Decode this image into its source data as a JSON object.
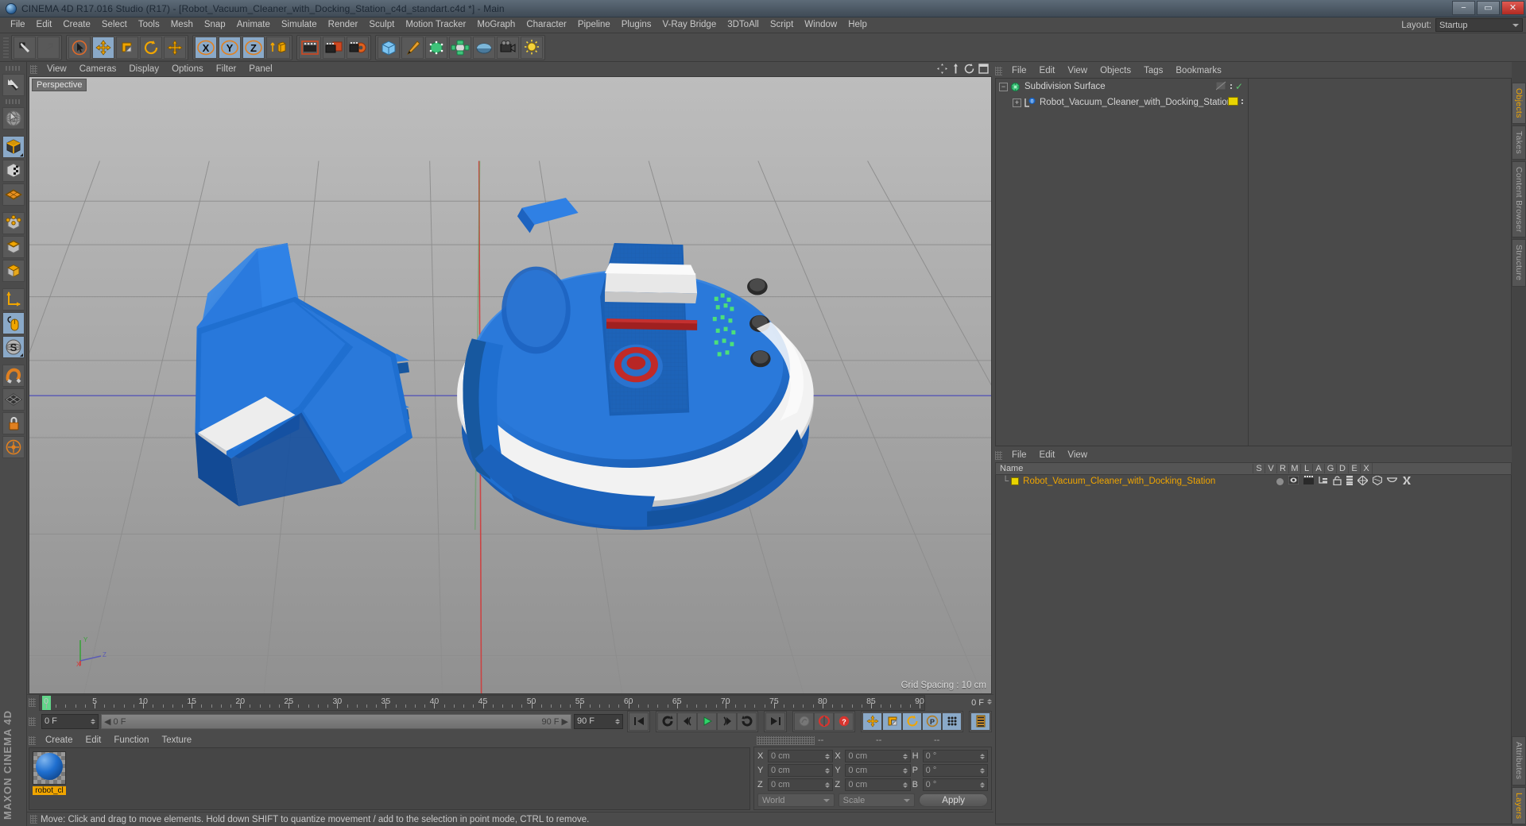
{
  "window": {
    "title": "CINEMA 4D R17.016 Studio (R17) - [Robot_Vacuum_Cleaner_with_Docking_Station_c4d_standart.c4d *] - Main",
    "minimize": "−",
    "maximize": "▭",
    "close": "✕"
  },
  "menubar": {
    "items": [
      "File",
      "Edit",
      "Create",
      "Select",
      "Tools",
      "Mesh",
      "Snap",
      "Animate",
      "Simulate",
      "Render",
      "Sculpt",
      "Motion Tracker",
      "MoGraph",
      "Character",
      "Pipeline",
      "Plugins",
      "V-Ray Bridge",
      "3DToAll",
      "Script",
      "Window",
      "Help"
    ],
    "layout_label": "Layout:",
    "layout_value": "Startup"
  },
  "toolbar": {
    "groups": [
      {
        "name": "undo-redo",
        "buttons": [
          {
            "icon": "undo-icon",
            "label": "Undo",
            "active": false
          },
          {
            "icon": "redo-icon",
            "label": "Redo",
            "active": false
          }
        ]
      },
      {
        "name": "tools",
        "buttons": [
          {
            "icon": "select-icon",
            "label": "Live Selection",
            "active": false
          },
          {
            "icon": "move-icon",
            "label": "Move",
            "active": true
          },
          {
            "icon": "scale-icon",
            "label": "Scale",
            "active": false
          },
          {
            "icon": "rotate-icon",
            "label": "Rotate",
            "active": false
          },
          {
            "icon": "move-axis-icon",
            "label": "Move Axis",
            "active": false
          }
        ]
      },
      {
        "name": "axis-locks",
        "buttons": [
          {
            "icon": "x-axis-icon",
            "label": "X Axis",
            "active": true
          },
          {
            "icon": "y-axis-icon",
            "label": "Y Axis",
            "active": true
          },
          {
            "icon": "z-axis-icon",
            "label": "Z Axis",
            "active": true
          },
          {
            "icon": "world-object-icon",
            "label": "World/Object Coordinate System",
            "active": false
          }
        ]
      },
      {
        "name": "render",
        "buttons": [
          {
            "icon": "render-view-icon",
            "label": "Render View",
            "active": false
          },
          {
            "icon": "render-picture-viewer-icon",
            "label": "Render to Picture Viewer",
            "active": false
          },
          {
            "icon": "render-settings-icon",
            "label": "Edit Render Settings",
            "active": false
          }
        ]
      },
      {
        "name": "objects",
        "buttons": [
          {
            "icon": "cube-primitive-icon",
            "label": "Add Cube Object",
            "active": false
          },
          {
            "icon": "pen-spline-icon",
            "label": "Add Spline Object",
            "active": false
          },
          {
            "icon": "generator-icon",
            "label": "Add Generator Object",
            "active": false
          },
          {
            "icon": "deformer-icon",
            "label": "Add Bend Object",
            "active": false
          },
          {
            "icon": "environment-icon",
            "label": "Add Environment Object",
            "active": false
          },
          {
            "icon": "camera-icon",
            "label": "Add Camera",
            "active": false
          },
          {
            "icon": "light-icon",
            "label": "Add Light",
            "active": false
          }
        ]
      }
    ]
  },
  "lefttoolbar": {
    "buttons": [
      {
        "icon": "undo-big-icon",
        "label": "Undo",
        "active": false
      },
      {
        "icon": "live-selection-icon",
        "label": "Live Selection",
        "active": false
      },
      {
        "icon": "model-mode-icon",
        "label": "Model Mode",
        "active": true
      },
      {
        "icon": "texture-mode-icon",
        "label": "Texture Mode",
        "active": false
      },
      {
        "icon": "workplane-icon",
        "label": "Workplane",
        "active": false
      },
      {
        "icon": "points-mode-icon",
        "label": "Points Mode",
        "active": false
      },
      {
        "icon": "edges-mode-icon",
        "label": "Edges Mode",
        "active": false
      },
      {
        "icon": "polygons-mode-icon",
        "label": "Polygons Mode",
        "active": false
      },
      {
        "icon": "axis-mode-icon",
        "label": "Enable Axis Modification",
        "active": false
      },
      {
        "icon": "viewport-solo-icon",
        "label": "Enable Snapping",
        "active": true
      },
      {
        "icon": "soft-selection-icon",
        "label": "Soft Selection",
        "active": true
      },
      {
        "icon": "magnet-icon",
        "label": "Magnet",
        "active": false
      },
      {
        "icon": "grid-icon",
        "label": "Grid Snap",
        "active": false
      },
      {
        "icon": "lock-icon",
        "label": "Lock Workplane",
        "active": false
      },
      {
        "icon": "workplane-mode-icon",
        "label": "Planar Workplane",
        "active": false
      }
    ],
    "brand": "MAXON CINEMA 4D"
  },
  "viewport": {
    "menu": [
      "View",
      "Cameras",
      "Display",
      "Options",
      "Filter",
      "Panel"
    ],
    "label": "Perspective",
    "grid_spacing": "Grid Spacing : 10 cm",
    "axis": {
      "x": "X",
      "y": "Y",
      "z": "Z"
    },
    "icons": [
      "pan-icon",
      "zoom-icon",
      "rotate-view-icon",
      "maximize-view-icon"
    ]
  },
  "timeline": {
    "ticks": [
      0,
      5,
      10,
      15,
      20,
      25,
      30,
      35,
      40,
      45,
      50,
      55,
      60,
      65,
      70,
      75,
      80,
      85,
      90
    ],
    "current_frame_ruler": "0 F",
    "current_frame_field": "0 F",
    "slider_start": "0 F",
    "slider_end": "90 F",
    "end_frame_field": "90 F",
    "playhead_frame": 0,
    "buttons": [
      {
        "icon": "go-to-start-icon",
        "label": "Go to Start",
        "active": false
      },
      {
        "icon": "play-backward-loop-icon",
        "label": "Play Backwards",
        "active": false
      },
      {
        "icon": "previous-frame-icon",
        "label": "Go to Previous Frame",
        "active": false
      },
      {
        "icon": "play-forward-icon",
        "label": "Play Forwards",
        "active": false
      },
      {
        "icon": "next-frame-icon",
        "label": "Go to Next Frame",
        "active": false
      },
      {
        "icon": "play-loop-icon",
        "label": "Play Loop",
        "active": false
      },
      {
        "icon": "go-to-end-icon",
        "label": "Go to End",
        "active": false
      },
      {
        "icon": "record-active-objects-icon",
        "label": "Record Active Objects",
        "active": false
      },
      {
        "icon": "autokeying-icon",
        "label": "Autokeying",
        "active": false
      },
      {
        "icon": "keyframe-selection-icon",
        "label": "Keyframe Selection",
        "active": false
      },
      {
        "icon": "position-key-icon",
        "label": "Position",
        "active": true
      },
      {
        "icon": "scale-key-icon",
        "label": "Scale",
        "active": true
      },
      {
        "icon": "rotation-key-icon",
        "label": "Rotation",
        "active": true
      },
      {
        "icon": "param-key-icon",
        "label": "Parameter",
        "active": true
      },
      {
        "icon": "pla-key-icon",
        "label": "Point Level Animation",
        "active": true
      },
      {
        "icon": "timeline-icon",
        "label": "Timeline",
        "active": true
      }
    ]
  },
  "object_manager": {
    "menu": [
      "File",
      "Edit",
      "View",
      "Objects",
      "Tags",
      "Bookmarks"
    ],
    "rows": [
      {
        "name": "Subdivision Surface",
        "indent": 0,
        "icon": "subdivision-surface-icon",
        "selected": false,
        "tag_color": "none",
        "check": true
      },
      {
        "name": "Robot_Vacuum_Cleaner_with_Docking_Station",
        "indent": 1,
        "icon": "null-object-icon",
        "selected": false,
        "tag_color": "#e8d400",
        "check": false
      }
    ]
  },
  "material_manager": {
    "menu": [
      "File",
      "Edit",
      "View"
    ],
    "columns": [
      "Name",
      "S",
      "V",
      "R",
      "M",
      "L",
      "A",
      "G",
      "D",
      "E",
      "X"
    ],
    "rows": [
      {
        "name": "Robot_Vacuum_Cleaner_with_Docking_Station",
        "chip_color": "#e8d400"
      }
    ]
  },
  "materials_panel": {
    "menu": [
      "Create",
      "Edit",
      "Function",
      "Texture"
    ],
    "materials": [
      {
        "name": "robot_cl",
        "color": "#1f6fd0"
      }
    ]
  },
  "coordinates": {
    "headers": [
      "--",
      "--",
      "--"
    ],
    "position": {
      "label_x": "X",
      "label_y": "Y",
      "label_z": "Z",
      "x": "0 cm",
      "y": "0 cm",
      "z": "0 cm"
    },
    "size": {
      "label_x": "X",
      "label_y": "Y",
      "label_z": "Z",
      "x": "0 cm",
      "y": "0 cm",
      "z": "0 cm"
    },
    "rotation": {
      "label_h": "H",
      "label_p": "P",
      "label_b": "B",
      "h": "0 °",
      "p": "0 °",
      "b": "0 °"
    },
    "system": "World",
    "mode": "Scale",
    "apply": "Apply"
  },
  "statusbar": {
    "text": "Move: Click and drag to move elements. Hold down SHIFT to quantize movement / add to the selection in point mode, CTRL to remove."
  },
  "edge_tabs": {
    "top": [
      {
        "label": "Objects",
        "active": true
      },
      {
        "label": "Takes",
        "active": false
      },
      {
        "label": "Content Browser",
        "active": false
      },
      {
        "label": "Structure",
        "active": false
      }
    ],
    "bottom": [
      {
        "label": "Attributes",
        "active": false
      },
      {
        "label": "Layers",
        "active": true
      }
    ]
  },
  "colors": {
    "accent_orange": "#f0a500",
    "selection_blue": "#8aa9c8",
    "panel_bg": "#4b4b4b",
    "model_blue": "#1f6fd0",
    "playhead_green": "#62d68a"
  }
}
